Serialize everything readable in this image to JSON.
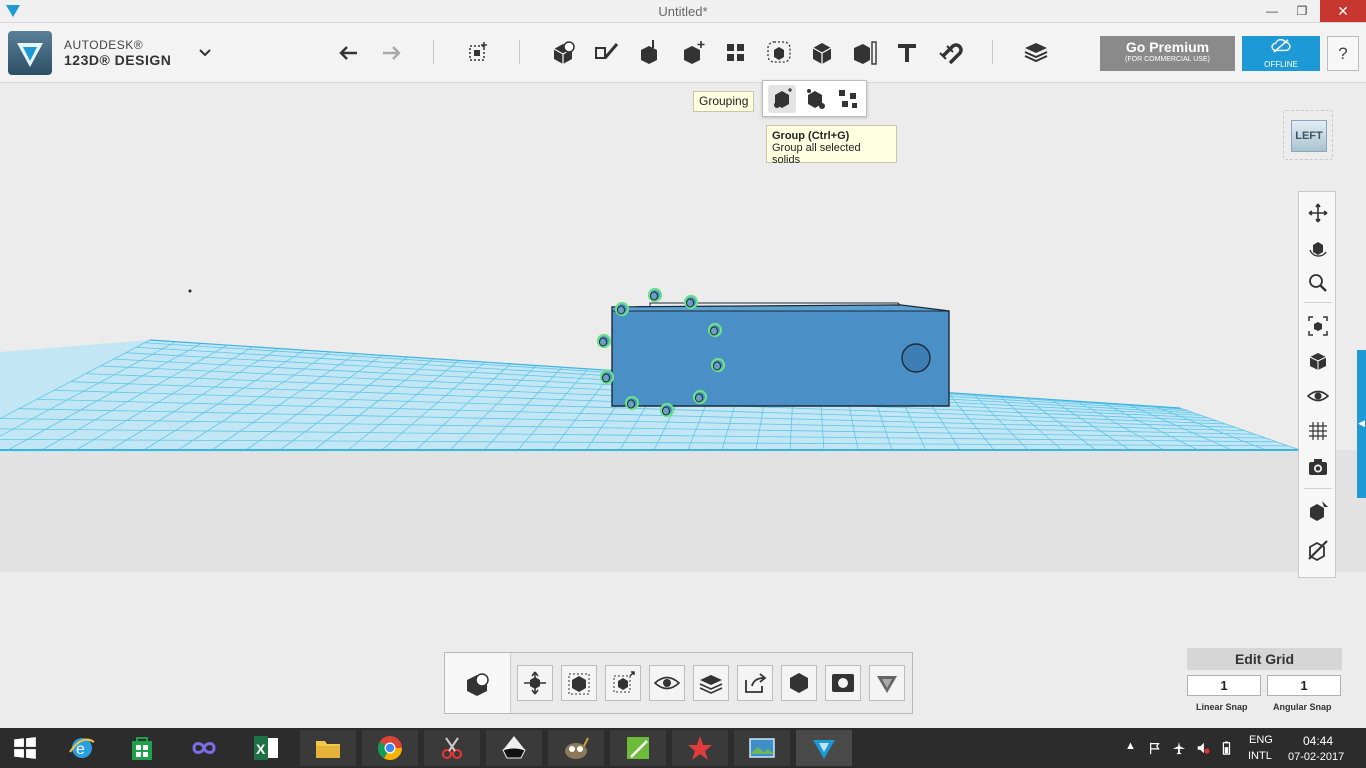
{
  "window": {
    "title": "Untitled*",
    "minimize": "—",
    "restore": "❐",
    "close": "✕"
  },
  "brand": {
    "line1": "AUTODESK®",
    "line2": "123D® DESIGN"
  },
  "toolbar": {
    "undo": "undo-icon",
    "redo": "redo-icon",
    "tools": [
      "transform",
      "primitives",
      "sketch",
      "construct",
      "modify",
      "pattern",
      "grouping",
      "combine",
      "measure",
      "text",
      "snap",
      "materials"
    ]
  },
  "premium": {
    "label": "Go Premium",
    "sub": "(FOR COMMERCIAL USE)"
  },
  "offline": {
    "label": "OFFLINE"
  },
  "help": {
    "label": "?"
  },
  "tooltips": {
    "grouping": "Grouping",
    "group_title": "Group (Ctrl+G)",
    "group_desc": "Group all selected solids"
  },
  "viewcube": {
    "face": "LEFT"
  },
  "edit_grid": {
    "title": "Edit Grid",
    "linear_value": "1",
    "angular_value": "1",
    "linear_label": "Linear Snap",
    "angular_label": "Angular Snap"
  },
  "taskbar": {
    "lang1": "ENG",
    "lang2": "INTL",
    "time": "04:44",
    "date": "07-02-2017"
  },
  "colors": {
    "accent": "#1d9ad6",
    "solid": "#4a8fc5",
    "grid": "#5ec6e8",
    "premium": "#8a8a8a",
    "close": "#c7372f"
  }
}
